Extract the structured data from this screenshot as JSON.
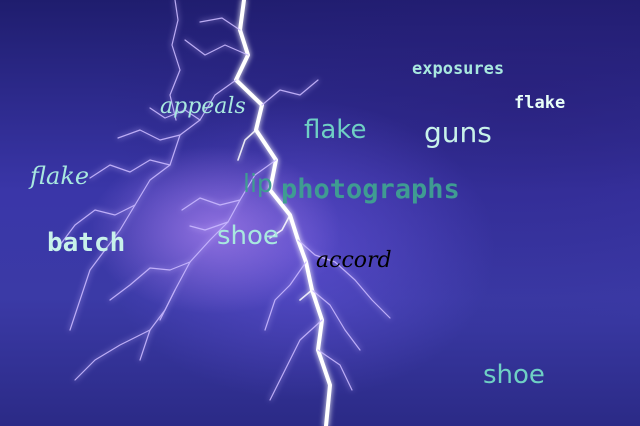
{
  "words": {
    "exposures": "exposures",
    "flake_top_right": "flake",
    "appeals": "appeals",
    "flake_center": "flake",
    "guns": "guns",
    "flake_left": "flake",
    "lip": "lip",
    "photographs": "photographs",
    "batch": "batch",
    "shoe_center": "shoe",
    "accord": "accord",
    "shoe_bottom": "shoe"
  },
  "colors": {
    "sky_dark": "#1f1d6e",
    "sky_mid": "#3a36a8",
    "lightning_core": "#ffffff",
    "lightning_glow": "#b79cff",
    "text_mint": "#a8e8df",
    "text_teal": "#3f9c92",
    "text_black": "#000000"
  }
}
